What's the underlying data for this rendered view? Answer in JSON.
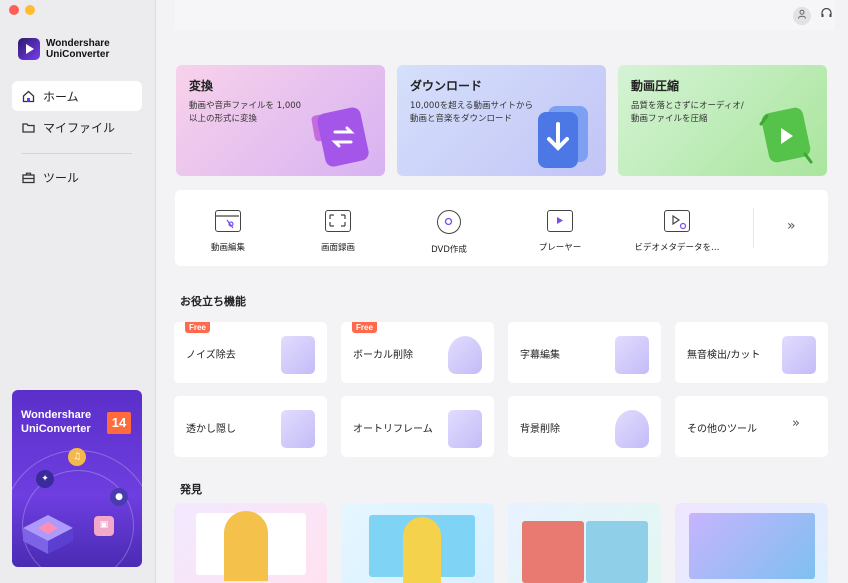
{
  "brand": {
    "line1": "Wondershare",
    "line2": "UniConverter"
  },
  "sidebar": {
    "items": [
      {
        "label": "ホーム",
        "icon": "home-icon",
        "active": true
      },
      {
        "label": "マイファイル",
        "icon": "folder-icon",
        "active": false
      },
      {
        "label": "ツール",
        "icon": "toolbox-icon",
        "active": false
      }
    ],
    "promo": {
      "line1": "Wondershare",
      "line2": "UniConverter",
      "version": "14"
    }
  },
  "topbar": {
    "icons": [
      "user-icon",
      "headset-icon"
    ]
  },
  "hero": [
    {
      "title": "変換",
      "desc": "動画や音声ファイルを 1,000以上の形式に変換",
      "icon": "convert-icon",
      "bg_from": "#f6c9e6",
      "bg_to": "#d9b2f4"
    },
    {
      "title": "ダウンロード",
      "desc": "10,000を超える動画サイトから動画と音楽をダウンロード",
      "icon": "download-icon",
      "bg_from": "#cfd9fb",
      "bg_to": "#c3c6f6"
    },
    {
      "title": "動画圧縮",
      "desc": "品質を落とさずにオーディオ/動画ファイルを圧縮",
      "icon": "compress-icon",
      "bg_from": "#cdf1cd",
      "bg_to": "#a7e39b"
    }
  ],
  "tools": [
    {
      "label": "動画編集",
      "icon": "video-edit-icon"
    },
    {
      "label": "画面録画",
      "icon": "screen-record-icon"
    },
    {
      "label": "DVD作成",
      "icon": "dvd-icon"
    },
    {
      "label": "プレーヤー",
      "icon": "player-icon"
    },
    {
      "label": "ビデオメタデータを…",
      "icon": "metadata-icon"
    }
  ],
  "useful": {
    "title": "お役立ち機能",
    "badge": "Free",
    "cards": [
      {
        "label": "ノイズ除去",
        "free": true,
        "icon": "noise-icon"
      },
      {
        "label": "ボーカル削除",
        "free": true,
        "icon": "vocal-icon"
      },
      {
        "label": "字幕編集",
        "free": false,
        "icon": "subtitle-icon"
      },
      {
        "label": "無音検出/カット",
        "free": false,
        "icon": "silence-icon"
      },
      {
        "label": "透かし隠し",
        "free": false,
        "icon": "watermark-icon"
      },
      {
        "label": "オートリフレーム",
        "free": false,
        "icon": "reframe-icon"
      },
      {
        "label": "背景削除",
        "free": false,
        "icon": "background-icon"
      },
      {
        "label": "その他のツール",
        "free": false,
        "icon": "chevrons-right-icon"
      }
    ]
  },
  "discover": {
    "title": "発見"
  },
  "colors": {
    "accent": "#6b3cf0",
    "free_badge": "#ff6a4d"
  }
}
